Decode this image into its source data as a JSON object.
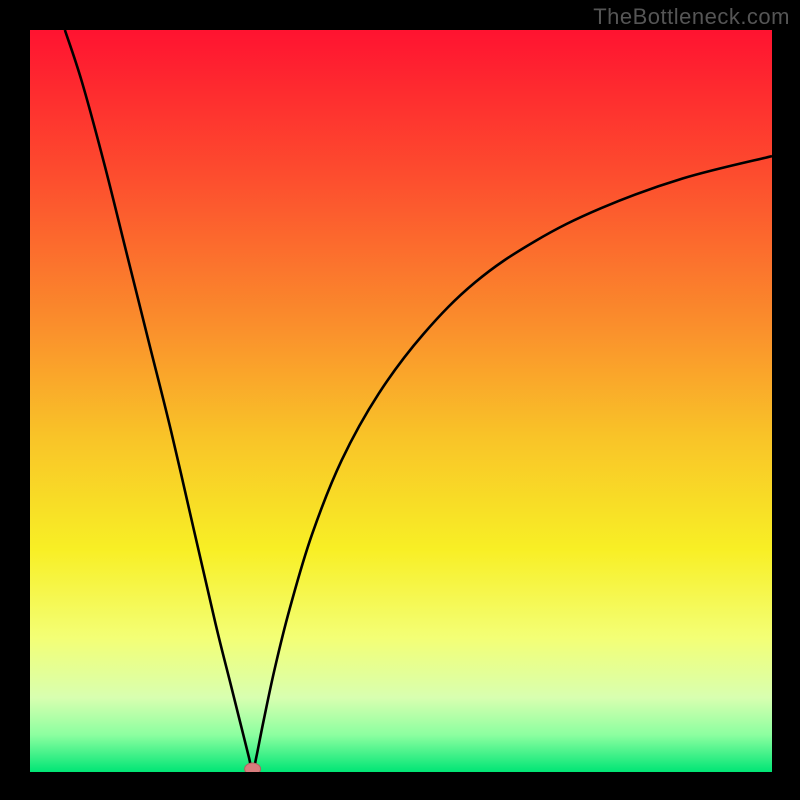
{
  "watermark": "TheBottleneck.com",
  "colors": {
    "frame": "#000000",
    "watermark": "#555555",
    "gradient_stops": [
      {
        "offset": 0.0,
        "color": "#ff1330"
      },
      {
        "offset": 0.2,
        "color": "#fd4e2e"
      },
      {
        "offset": 0.4,
        "color": "#fa8f2c"
      },
      {
        "offset": 0.55,
        "color": "#f9c428"
      },
      {
        "offset": 0.7,
        "color": "#f8ef25"
      },
      {
        "offset": 0.82,
        "color": "#f3ff76"
      },
      {
        "offset": 0.9,
        "color": "#d8ffb0"
      },
      {
        "offset": 0.95,
        "color": "#8cffa0"
      },
      {
        "offset": 1.0,
        "color": "#00e575"
      }
    ],
    "curve": "#000000",
    "marker_fill": "#d77d7d",
    "marker_stroke": "#b46060"
  },
  "chart_data": {
    "type": "line",
    "title": "",
    "xlabel": "",
    "ylabel": "",
    "x_range": [
      0,
      100
    ],
    "y_range": [
      0,
      100
    ],
    "min_x": 30,
    "min_y": 0,
    "marker": {
      "x": 30,
      "y": 0
    },
    "left_branch": [
      {
        "x": 4.7,
        "y": 100
      },
      {
        "x": 7,
        "y": 93
      },
      {
        "x": 10,
        "y": 82
      },
      {
        "x": 13,
        "y": 70
      },
      {
        "x": 16,
        "y": 58
      },
      {
        "x": 19,
        "y": 46
      },
      {
        "x": 22,
        "y": 33
      },
      {
        "x": 25,
        "y": 20
      },
      {
        "x": 27,
        "y": 12
      },
      {
        "x": 28.5,
        "y": 6
      },
      {
        "x": 29.5,
        "y": 2
      },
      {
        "x": 30,
        "y": 0
      }
    ],
    "right_branch": [
      {
        "x": 30,
        "y": 0
      },
      {
        "x": 30.5,
        "y": 2
      },
      {
        "x": 31.5,
        "y": 7
      },
      {
        "x": 33,
        "y": 14
      },
      {
        "x": 35,
        "y": 22
      },
      {
        "x": 38,
        "y": 32
      },
      {
        "x": 42,
        "y": 42
      },
      {
        "x": 47,
        "y": 51
      },
      {
        "x": 53,
        "y": 59
      },
      {
        "x": 60,
        "y": 66
      },
      {
        "x": 68,
        "y": 71.5
      },
      {
        "x": 77,
        "y": 76
      },
      {
        "x": 88,
        "y": 80
      },
      {
        "x": 100,
        "y": 83
      }
    ]
  }
}
